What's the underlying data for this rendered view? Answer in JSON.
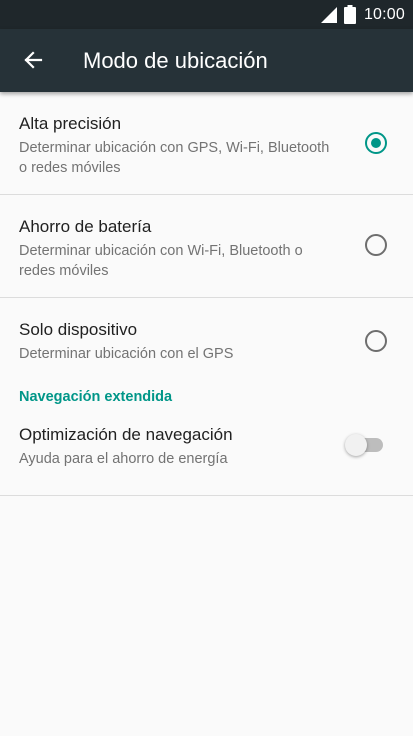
{
  "status_bar": {
    "time": "10:00",
    "signal_icon": "signal-icon",
    "battery_icon": "battery-icon"
  },
  "app_bar": {
    "back_icon": "arrow-back-icon",
    "title": "Modo de ubicación"
  },
  "options": [
    {
      "title": "Alta precisión",
      "subtitle": "Determinar ubicación con GPS, Wi-Fi, Bluetooth o redes móviles",
      "selected": true
    },
    {
      "title": "Ahorro de batería",
      "subtitle": "Determinar ubicación con Wi-Fi, Bluetooth o redes móviles",
      "selected": false
    },
    {
      "title": "Solo dispositivo",
      "subtitle": "Determinar ubicación con el GPS",
      "selected": false
    }
  ],
  "extended_section": {
    "header": "Navegación extendida",
    "item": {
      "title": "Optimización de navegación",
      "subtitle": "Ayuda para el ahorro de energía",
      "enabled": false
    }
  },
  "colors": {
    "accent": "#009688",
    "app_bar": "#263238",
    "status_bar": "#1f272b",
    "background": "#fafafa"
  }
}
